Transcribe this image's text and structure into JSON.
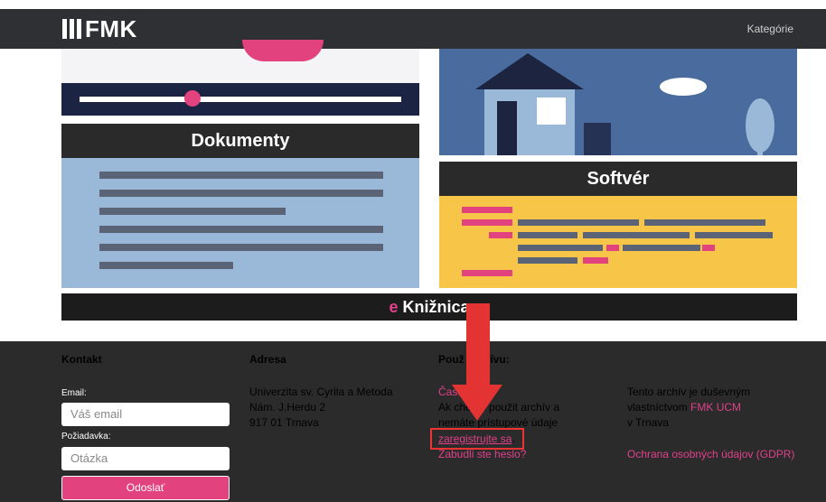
{
  "header": {
    "logo_text": "FMK",
    "nav_categories": "Kategórie"
  },
  "cards": {
    "documents_title": "Dokumenty",
    "software_title": "Softvér",
    "library_prefix": "e",
    "library_title": "Knižnica"
  },
  "footer": {
    "contact": {
      "heading": "Kontakt",
      "email_label": "Email:",
      "email_placeholder": "Váš email",
      "request_label": "Požiadavka:",
      "question_placeholder": "Otázka",
      "submit_label": "Odoslať"
    },
    "address": {
      "heading": "Adresa",
      "line1": "Univerzita sv. Cyrila a Metoda",
      "line2": "Nám. J.Herdu 2",
      "line3": "917 01 Trnava"
    },
    "archive": {
      "heading": "Použ   rchívu:",
      "faq_link": "Časte     ky",
      "line1": "Ak chcete použit archív a",
      "line2": "nemáte prístupové údaje",
      "register_link": "zaregistrujte sa",
      "register_period": ".",
      "forgot_link": "Zabudli ste heslo?"
    },
    "ownership": {
      "line1": "Tento archív je duševným",
      "line2_prefix": "vlastníctvom ",
      "line2_link": "FMK UCM",
      "line3": "v Trnava",
      "gdpr_link": "Ochrana osobných údajov (GDPR)"
    }
  },
  "colors": {
    "accent_pink": "#e2427d",
    "dark": "#2b2b2b",
    "highlight_red": "#e33333"
  }
}
